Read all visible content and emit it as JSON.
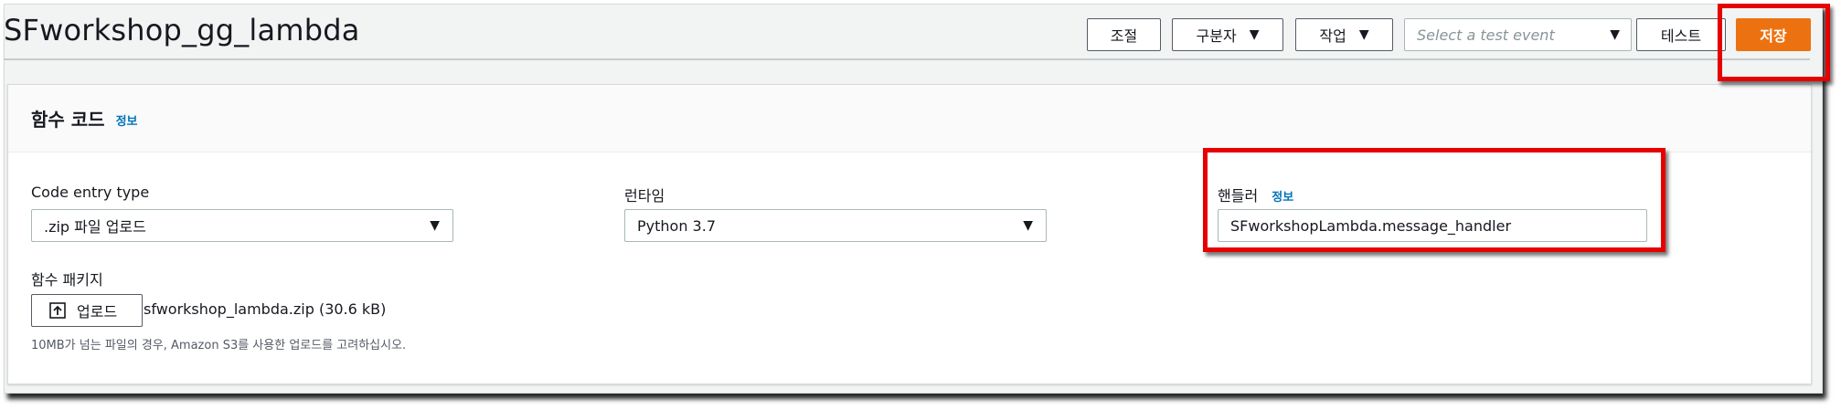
{
  "header": {
    "title": "SFworkshop_gg_lambda",
    "buttons": {
      "throttle": "조절",
      "qualifiers": "구분자",
      "actions": "작업",
      "test": "테스트",
      "save": "저장"
    },
    "test_event_placeholder": "Select a test event"
  },
  "panel": {
    "title": "함수 코드",
    "info": "정보",
    "code_entry_type": {
      "label": "Code entry type",
      "value": ".zip 파일 업로드"
    },
    "runtime": {
      "label": "런타임",
      "value": "Python 3.7"
    },
    "handler": {
      "label": "핸들러",
      "info": "정보",
      "value": "SFworkshopLambda.message_handler"
    },
    "package": {
      "label": "함수 패키지",
      "upload_label": "업로드",
      "file": "sfworkshop_lambda.zip (30.6 kB)",
      "hint": "10MB가 넘는 파일의 경우, Amazon S3를 사용한 업로드를 고려하십시오."
    }
  },
  "colors": {
    "primary": "#ec7211",
    "link": "#0073bb",
    "highlight": "#e60000"
  },
  "icons": [
    "caret-down-icon",
    "upload-icon"
  ]
}
